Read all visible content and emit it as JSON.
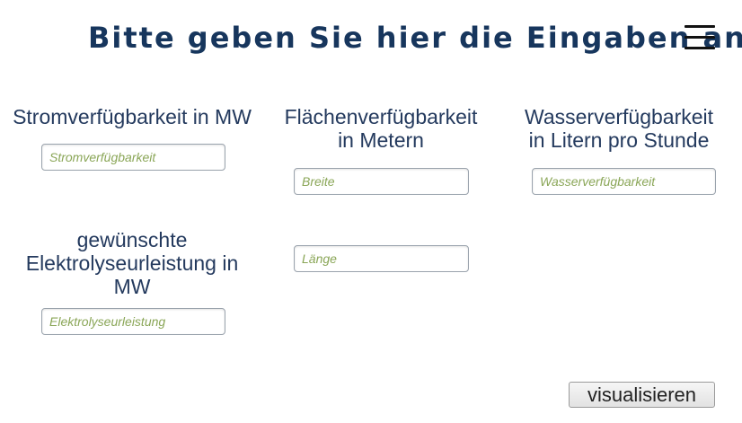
{
  "header": {
    "title": "Bitte geben Sie hier die Eingaben an",
    "menu_icon": "hamburger-menu-icon"
  },
  "form": {
    "strom": {
      "label": "Stromverfügbarkeit in MW",
      "placeholder": "Stromverfügbarkeit",
      "value": ""
    },
    "flaeche": {
      "label_line1": "Flächenverfügbarkeit",
      "label_line2": "in Metern",
      "breite_placeholder": "Breite",
      "laenge_placeholder": "Länge"
    },
    "wasser": {
      "label_line1": "Wasserverfügbarkeit",
      "label_line2": "in Litern pro Stunde",
      "placeholder": "Wasserverfügbarkeit"
    },
    "elektrolyse": {
      "label_line1": "gewünschte",
      "label_line2": "Elektrolyseurleistung in",
      "label_line3": "MW",
      "placeholder": "Elektrolyseurleistung"
    }
  },
  "actions": {
    "visualize_label": "visualisieren"
  },
  "colors": {
    "title": "#17365d",
    "label": "#243a5e",
    "placeholder": "#8aa657"
  }
}
